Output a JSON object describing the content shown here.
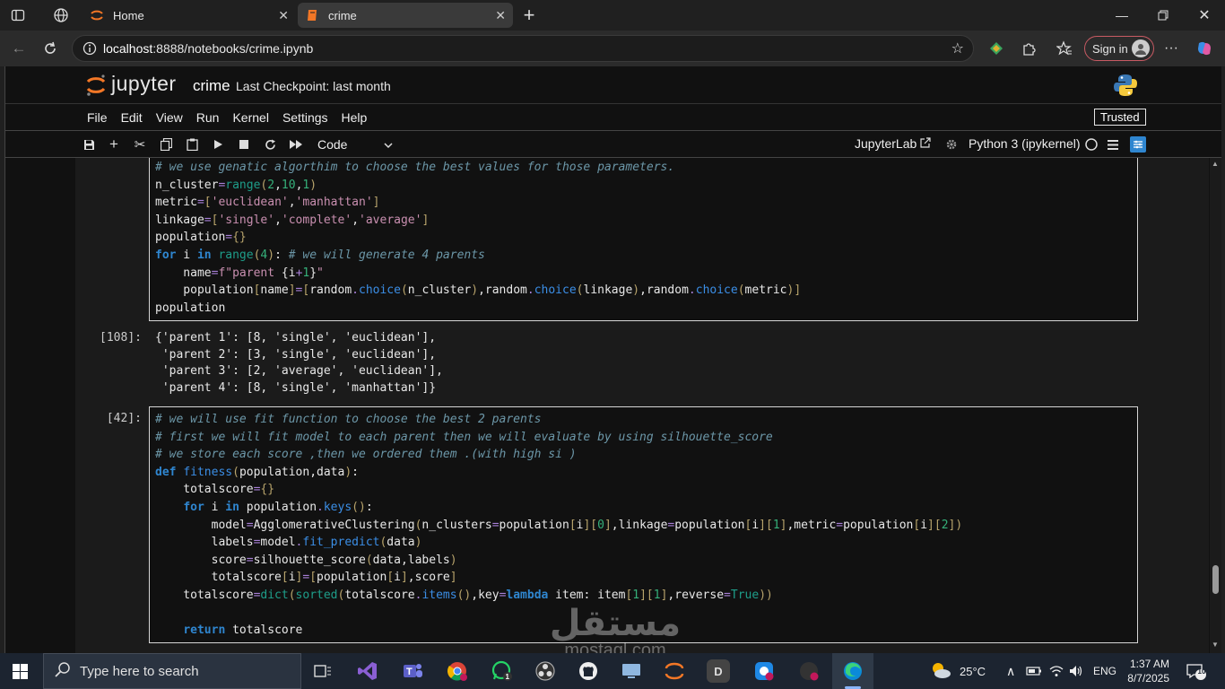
{
  "browser": {
    "tabs": [
      {
        "title": "Home"
      },
      {
        "title": "crime"
      }
    ],
    "url": {
      "host": "localhost",
      "rest": ":8888/notebooks/crime.ipynb"
    },
    "signin_label": "Sign in"
  },
  "jupyter": {
    "logo_text": "jupyter",
    "notebook_name": "crime",
    "checkpoint": "Last Checkpoint: last month",
    "trusted": "Trusted",
    "menus": [
      "File",
      "Edit",
      "View",
      "Run",
      "Kernel",
      "Settings",
      "Help"
    ],
    "cell_type": "Code",
    "jupyterlab_label": "JupyterLab",
    "kernel": "Python 3 (ipykernel)"
  },
  "cells": {
    "cell1_lines": [
      "# we use genatic algorthim to choose the best values for those parameters.",
      "n_cluster=range(2,10,1)",
      "metric=['euclidean','manhattan']",
      "linkage=['single','complete','average']",
      "population={}",
      "for i in range(4): # we will generate 4 parents",
      "    name=f\"parent {i+1}\"",
      "    population[name]=[random.choice(n_cluster),random.choice(linkage),random.choice(metric)]",
      "population"
    ],
    "out1_prompt": "[108]:",
    "out1_lines": [
      "{'parent 1': [8, 'single', 'euclidean'],",
      " 'parent 2': [3, 'single', 'euclidean'],",
      " 'parent 3': [2, 'average', 'euclidean'],",
      " 'parent 4': [8, 'single', 'manhattan']}"
    ],
    "cell2_prompt": "[42]:",
    "cell2_lines": [
      "# we will use fit function to choose the best 2 parents",
      "# first we will fit model to each parent then we will evaluate by using silhouette_score",
      "# we store each score ,then we ordered them .(with high si )",
      "def fitness(population,data):",
      "    totalscore={}",
      "    for i in population.keys():",
      "        model=AgglomerativeClustering(n_clusters=population[i][0],linkage=population[i][1],metric=population[i][2])",
      "        labels=model.fit_predict(data)",
      "        score=silhouette_score(data,labels)",
      "        totalscore[i]=[population[i],score]",
      "    totalscore=dict(sorted(totalscore.items(),key=lambda item: item[1][1],reverse=True))",
      "",
      "    return totalscore"
    ]
  },
  "taskbar": {
    "search_placeholder": "Type here to search",
    "weather": "25°C",
    "lang": "ENG",
    "time": "1:37 AM",
    "date": "8/7/2025",
    "notifications": "10",
    "app_d_label": "D"
  },
  "watermark": {
    "arabic": "مستقل",
    "latin": "mostaql.com"
  },
  "colors": {
    "accent": "#2f86d0",
    "jupyter_orange": "#f37726",
    "signin_border": "#c85a63"
  }
}
